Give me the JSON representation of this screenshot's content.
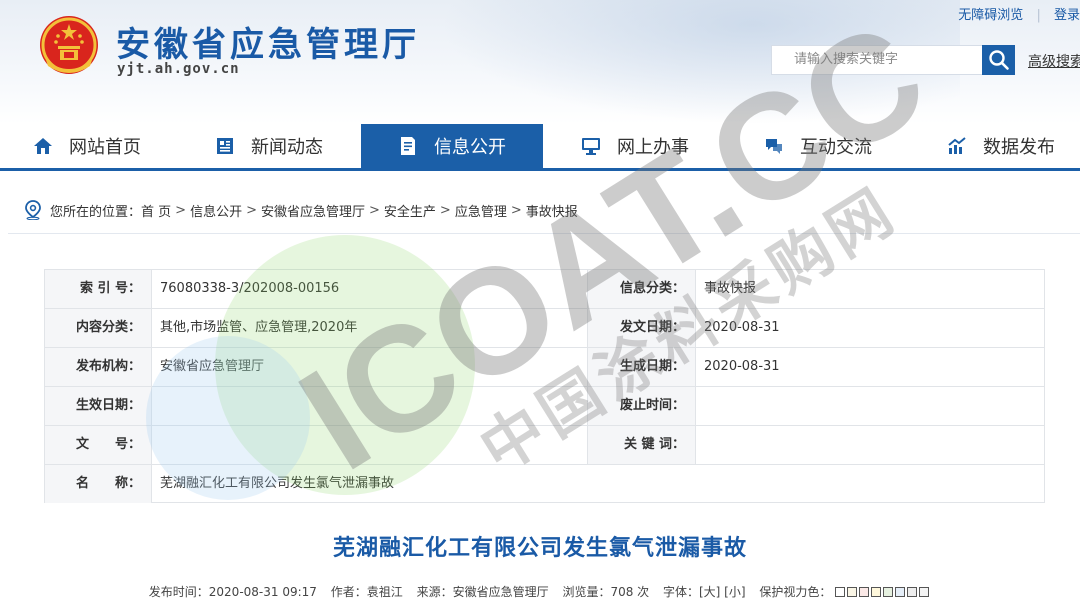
{
  "header": {
    "site_title": "安徽省应急管理厅",
    "domain": "yjt.ah.gov.cn",
    "top_links": [
      "无障碍浏览",
      "登录"
    ],
    "search_placeholder": "请输入搜索关键字",
    "advanced_search": "高级搜索"
  },
  "nav": {
    "items": [
      {
        "label": "网站首页",
        "icon": "home-icon"
      },
      {
        "label": "新闻动态",
        "icon": "news-icon"
      },
      {
        "label": "信息公开",
        "icon": "document-icon",
        "active": true
      },
      {
        "label": "网上办事",
        "icon": "monitor-icon"
      },
      {
        "label": "互动交流",
        "icon": "chat-icon"
      },
      {
        "label": "数据发布",
        "icon": "chart-icon"
      }
    ]
  },
  "breadcrumb": {
    "prefix": "您所在的位置：",
    "items": [
      "首 页",
      "信息公开",
      "安徽省应急管理厅",
      "安全生产",
      "应急管理",
      "事故快报"
    ],
    "separator": ">"
  },
  "meta": {
    "rows": [
      {
        "l1": "索 引 号：",
        "v1": "76080338-3/202008-00156",
        "l2": "信息分类：",
        "v2": "事故快报"
      },
      {
        "l1": "内容分类：",
        "v1": "其他,市场监管、应急管理,2020年",
        "l2": "发文日期：",
        "v2": "2020-08-31"
      },
      {
        "l1": "发布机构：",
        "v1": "安徽省应急管理厅",
        "l2": "生成日期：",
        "v2": "2020-08-31"
      },
      {
        "l1": "生效日期：",
        "v1": "",
        "l2": "废止时间：",
        "v2": ""
      },
      {
        "l1": "文　　号：",
        "v1": "",
        "l2": "关 键 词：",
        "v2": ""
      },
      {
        "l1": "名　　称：",
        "v1": "芜湖融汇化工有限公司发生氯气泄漏事故",
        "l2": "",
        "v2": ""
      }
    ]
  },
  "article": {
    "title": "芜湖融汇化工有限公司发生氯气泄漏事故",
    "published": "发布时间：2020-08-31 09:17",
    "author": "作者：袁祖江",
    "source": "来源：安徽省应急管理厅",
    "views": "浏览量：708 次",
    "font_size": "字体：[大] [小]",
    "eye_care": "保护视力色：",
    "eye_colors": [
      "#ffffff",
      "#faf6e6",
      "#fbe9e7",
      "#fff8dc",
      "#e6f1e0",
      "#e5eef8",
      "#eeeeee",
      "#f4f4f4"
    ]
  },
  "watermark": {
    "main": "ICOAT.CC",
    "sub": "中国涂料采购网"
  },
  "colors": {
    "brand_blue": "#1b5fa8",
    "title_blue": "#1a5aa6",
    "label_bg": "#f5f6f8"
  }
}
